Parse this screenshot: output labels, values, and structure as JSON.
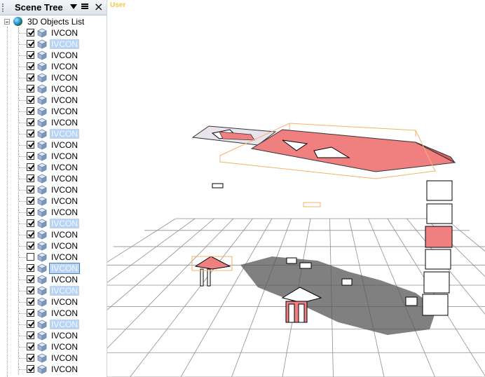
{
  "panel": {
    "title": "Scene Tree",
    "icons": [
      "pin-dropdown-icon",
      "menu-icon",
      "close-icon"
    ]
  },
  "tree": {
    "root_label": "3D Objects List",
    "items": [
      {
        "label": "IVCON",
        "checked": true,
        "selected": false
      },
      {
        "label": "IVCON",
        "checked": true,
        "selected": true
      },
      {
        "label": "IVCON",
        "checked": true,
        "selected": false
      },
      {
        "label": "IVCON",
        "checked": true,
        "selected": false
      },
      {
        "label": "IVCON",
        "checked": true,
        "selected": false
      },
      {
        "label": "IVCON",
        "checked": true,
        "selected": false
      },
      {
        "label": "IVCON",
        "checked": true,
        "selected": false
      },
      {
        "label": "IVCON",
        "checked": true,
        "selected": false
      },
      {
        "label": "IVCON",
        "checked": true,
        "selected": false
      },
      {
        "label": "IVCON",
        "checked": true,
        "selected": true
      },
      {
        "label": "IVCON",
        "checked": true,
        "selected": false
      },
      {
        "label": "IVCON",
        "checked": true,
        "selected": false
      },
      {
        "label": "IVCON",
        "checked": true,
        "selected": false
      },
      {
        "label": "IVCON",
        "checked": true,
        "selected": false
      },
      {
        "label": "IVCON",
        "checked": true,
        "selected": false
      },
      {
        "label": "IVCON",
        "checked": true,
        "selected": false
      },
      {
        "label": "IVCON",
        "checked": true,
        "selected": false
      },
      {
        "label": "IVCON",
        "checked": true,
        "selected": true
      },
      {
        "label": "IVCON",
        "checked": true,
        "selected": false
      },
      {
        "label": "IVCON",
        "checked": true,
        "selected": false
      },
      {
        "label": "IVCON",
        "checked": false,
        "selected": false
      },
      {
        "label": "IVCON",
        "checked": true,
        "selected": true,
        "focused": true
      },
      {
        "label": "IVCON",
        "checked": true,
        "selected": false
      },
      {
        "label": "IVCON",
        "checked": true,
        "selected": true
      },
      {
        "label": "IVCON",
        "checked": true,
        "selected": false
      },
      {
        "label": "IVCON",
        "checked": true,
        "selected": false
      },
      {
        "label": "IVCON",
        "checked": true,
        "selected": true
      },
      {
        "label": "IVCON",
        "checked": true,
        "selected": false
      },
      {
        "label": "IVCON",
        "checked": true,
        "selected": false
      },
      {
        "label": "IVCON",
        "checked": true,
        "selected": false
      },
      {
        "label": "IVCON",
        "checked": true,
        "selected": false
      }
    ]
  },
  "viewport": {
    "view_label": "User",
    "colors": {
      "selected_fill": "#f08080",
      "bbox": "#f5b26b",
      "grid": "#8f8f8f",
      "shadow": "#555555"
    }
  }
}
